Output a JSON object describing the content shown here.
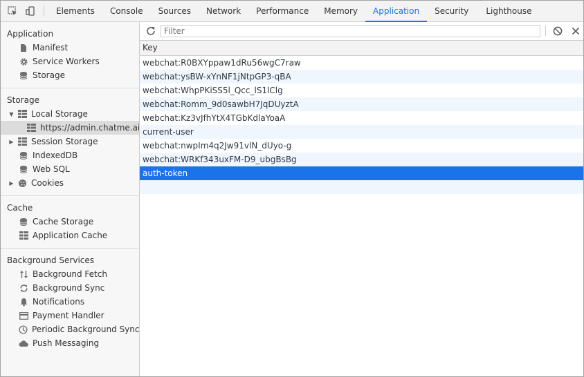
{
  "tabs": [
    {
      "label": "Elements",
      "name": "tab-elements"
    },
    {
      "label": "Console",
      "name": "tab-console"
    },
    {
      "label": "Sources",
      "name": "tab-sources"
    },
    {
      "label": "Network",
      "name": "tab-network"
    },
    {
      "label": "Performance",
      "name": "tab-performance"
    },
    {
      "label": "Memory",
      "name": "tab-memory"
    },
    {
      "label": "Application",
      "name": "tab-application",
      "active": true
    },
    {
      "label": "Security",
      "name": "tab-security"
    },
    {
      "label": "Lighthouse",
      "name": "tab-lighthouse"
    }
  ],
  "sidebar": {
    "application": {
      "title": "Application",
      "items": [
        {
          "label": "Manifest",
          "icon": "file-icon"
        },
        {
          "label": "Service Workers",
          "icon": "gear-icon"
        },
        {
          "label": "Storage",
          "icon": "database-icon"
        }
      ]
    },
    "storage": {
      "title": "Storage",
      "local_storage": {
        "label": "Local Storage",
        "icon": "grid-icon",
        "child": "https://admin.chatme.ai"
      },
      "session_storage": {
        "label": "Session Storage",
        "icon": "grid-icon"
      },
      "indexeddb": {
        "label": "IndexedDB",
        "icon": "database-icon"
      },
      "websql": {
        "label": "Web SQL",
        "icon": "database-icon"
      },
      "cookies": {
        "label": "Cookies",
        "icon": "cookie-icon"
      }
    },
    "cache": {
      "title": "Cache",
      "items": [
        {
          "label": "Cache Storage",
          "icon": "database-icon"
        },
        {
          "label": "Application Cache",
          "icon": "grid-icon"
        }
      ]
    },
    "background": {
      "title": "Background Services",
      "items": [
        {
          "label": "Background Fetch",
          "icon": "arrows-updown-icon"
        },
        {
          "label": "Background Sync",
          "icon": "sync-icon"
        },
        {
          "label": "Notifications",
          "icon": "bell-icon"
        },
        {
          "label": "Payment Handler",
          "icon": "card-icon"
        },
        {
          "label": "Periodic Background Sync",
          "icon": "clock-icon"
        },
        {
          "label": "Push Messaging",
          "icon": "cloud-icon"
        }
      ]
    }
  },
  "toolbar": {
    "filter_placeholder": "Filter"
  },
  "table": {
    "column": "Key",
    "rows": [
      "webchat:R0BXYppaw1dRu56wgC7raw",
      "webchat:ysBW-xYnNF1jNtpGP3-qBA",
      "webchat:WhpPKiSS5l_Qcc_lS1lClg",
      "webchat:Romm_9d0sawbH7JqDUyztA",
      "webchat:Kz3vJfhYtX4TGbKdlaYoaA",
      "current-user",
      "webchat:nwpIm4q2Jw91vlN_dUyo-g",
      "webchat:WRKf343uxFM-D9_ubgBsBg",
      "auth-token"
    ],
    "selected_index": 8
  },
  "colors": {
    "accent": "#1a73e8",
    "row_alt": "#f0f6fe"
  }
}
